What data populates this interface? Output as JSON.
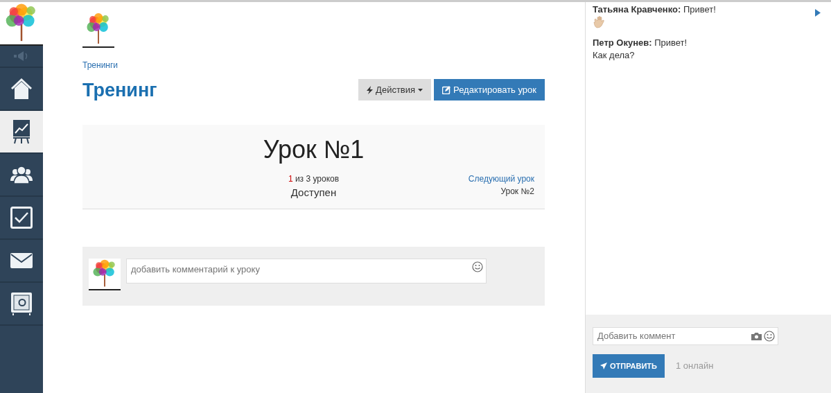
{
  "sidebar": {
    "items": [
      {
        "kind": "speaker",
        "selected": false
      },
      {
        "kind": "home",
        "selected": false
      },
      {
        "kind": "chart",
        "selected": true
      },
      {
        "kind": "people",
        "selected": false
      },
      {
        "kind": "check",
        "selected": false
      },
      {
        "kind": "mail",
        "selected": false
      },
      {
        "kind": "safe",
        "selected": false
      }
    ]
  },
  "breadcrumb": "Тренинги",
  "title": "Тренинг",
  "actions_button": "Действия",
  "edit_button": "Редактировать урок",
  "lesson": {
    "title": "Урок №1",
    "progress_current": "1",
    "progress_text": "из 3 уроков",
    "status": "Доступен",
    "next_label": "Следующий урок",
    "next_title": "Урок №2"
  },
  "comment": {
    "placeholder": "добавить комментарий к уроку"
  },
  "chat": {
    "messages": [
      {
        "author": "Татьяна Кравченко:",
        "text": "Привет!",
        "wave_emoji": true
      },
      {
        "author": "Петр Окунев:",
        "text": "Привет!",
        "more": [
          "Как дела?"
        ]
      }
    ],
    "input": {
      "placeholder": "Добавить коммент"
    },
    "send_button": "ОТПРАВИТЬ",
    "online": "1 онлайн"
  }
}
